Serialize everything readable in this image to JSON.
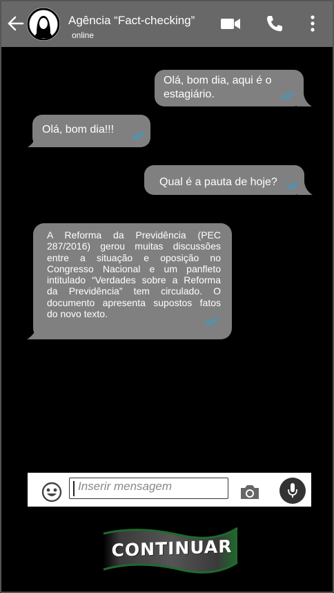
{
  "header": {
    "contact_name": "Agência “Fact-checking”",
    "status": "online",
    "icons": [
      "back-arrow-icon",
      "avatar-woman-icon",
      "video-call-icon",
      "phone-icon",
      "more-vertical-icon"
    ]
  },
  "messages": [
    {
      "side": "sent",
      "lines": [
        "Olá, bom dia, aqui é o",
        "estagiário."
      ]
    },
    {
      "side": "received",
      "lines": [
        "Olá, bom dia!!!"
      ]
    },
    {
      "side": "sent",
      "lines": [
        "Qual é a pauta de hoje?"
      ]
    },
    {
      "side": "received",
      "lines": [
        "A Reforma da Previdência (PEC",
        "287/2016) gerou muitas discussões",
        "entre a situação e oposição no",
        "Congresso Nacional e um panfleto",
        "intitulado “Verdades sobre a Reforma",
        "da Previdência” tem circulado. O",
        "documento apresenta supostos fatos",
        "do novo texto."
      ]
    }
  ],
  "composer": {
    "placeholder": "Inserir mensagem",
    "icons": [
      "emoji-icon",
      "camera-icon",
      "microphone-icon"
    ]
  },
  "continue_button": {
    "label": "CONTINUAR"
  },
  "colors": {
    "header": "#686868",
    "bubble": "#808080",
    "check": "#2aa3d9",
    "banner": "#1e6b2c"
  }
}
